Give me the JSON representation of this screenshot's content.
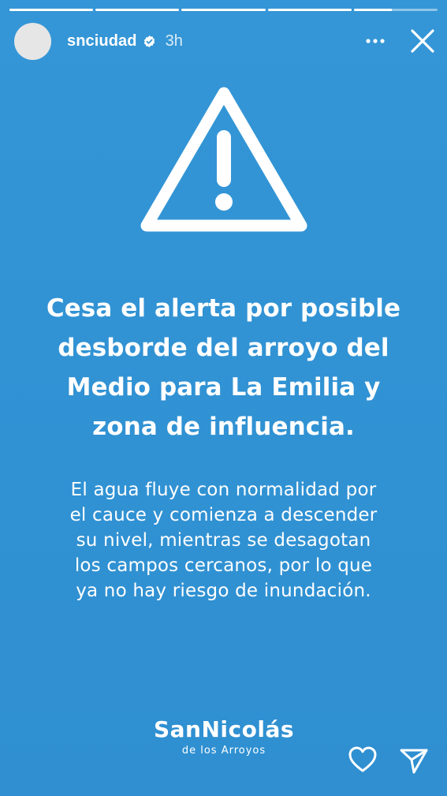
{
  "story": {
    "progress": [
      1,
      1,
      1,
      1,
      0.45
    ],
    "background_color": "#3193d4"
  },
  "header": {
    "username": "snciudad",
    "verified": true,
    "time": "3h",
    "more_icon": "more-horizontal-icon",
    "close_icon": "close-icon"
  },
  "content": {
    "warning_icon": "warning-triangle-icon",
    "headline": [
      "Cesa el alerta por posible",
      "desborde del arroyo del",
      "Medio para La Emilia y",
      "zona de influencia."
    ],
    "body": [
      "El agua fluye con normalidad por",
      "el cauce y comienza a descender",
      "su nivel, mientras se desagotan",
      "los campos cercanos, por lo que",
      "ya no hay riesgo de inundación."
    ]
  },
  "logo": {
    "name": "SanNicolás",
    "subtitle": "de los Arroyos"
  },
  "footer": {
    "like_icon": "heart-icon",
    "share_icon": "send-icon"
  }
}
